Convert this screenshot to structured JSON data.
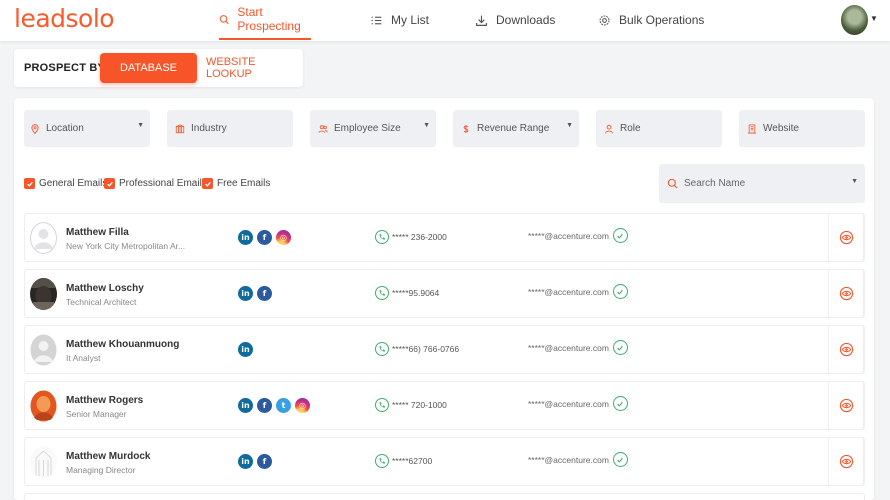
{
  "brand": {
    "logo_part1": "lead",
    "logo_part2": "solo"
  },
  "nav": {
    "items": [
      {
        "label": "Start Prospecting",
        "icon": "search-icon"
      },
      {
        "label": "My List",
        "icon": "list-icon"
      },
      {
        "label": "Downloads",
        "icon": "download-icon"
      },
      {
        "label": "Bulk Operations",
        "icon": "gear-icon"
      }
    ]
  },
  "prospect": {
    "label": "PROSPECT BY",
    "database": "DATABASE",
    "website_lookup": "WEBSITE LOOKUP"
  },
  "filters": [
    {
      "label": "Location",
      "icon": "map-pin-icon"
    },
    {
      "label": "Industry",
      "icon": "building-icon"
    },
    {
      "label": "Employee Size",
      "icon": "users-icon"
    },
    {
      "label": "Revenue Range",
      "icon": "dollar-icon"
    },
    {
      "label": "Role",
      "icon": "person-icon"
    },
    {
      "label": "Website",
      "icon": "office-icon"
    }
  ],
  "email_types": [
    "General Emails",
    "Professional Emails",
    "Free Emails"
  ],
  "search": {
    "placeholder": "Search Name"
  },
  "colors": {
    "accent": "#f4572c",
    "verified": "#3fae6e"
  },
  "contacts": [
    {
      "name": "Matthew Filla",
      "title": "New York City Metropolitan Ar...",
      "socials": [
        "linkedin",
        "facebook",
        "instagram"
      ],
      "phone": "***** 236-2000",
      "email": "*****@accenture.com"
    },
    {
      "name": "Matthew Loschy",
      "title": "Technical Architect",
      "socials": [
        "linkedin",
        "facebook"
      ],
      "phone": "*****95.9064",
      "email": "*****@accenture.com"
    },
    {
      "name": "Matthew Khouanmuong",
      "title": "It Analyst",
      "socials": [
        "linkedin"
      ],
      "phone": "*****66) 766-0766",
      "email": "*****@accenture.com"
    },
    {
      "name": "Matthew Rogers",
      "title": "Senior Manager",
      "socials": [
        "linkedin",
        "facebook",
        "twitter",
        "instagram"
      ],
      "phone": "***** 720-1000",
      "email": "*****@accenture.com"
    },
    {
      "name": "Matthew Murdock",
      "title": "Managing Director",
      "socials": [
        "linkedin",
        "facebook"
      ],
      "phone": "*****62700",
      "email": "*****@accenture.com"
    }
  ]
}
